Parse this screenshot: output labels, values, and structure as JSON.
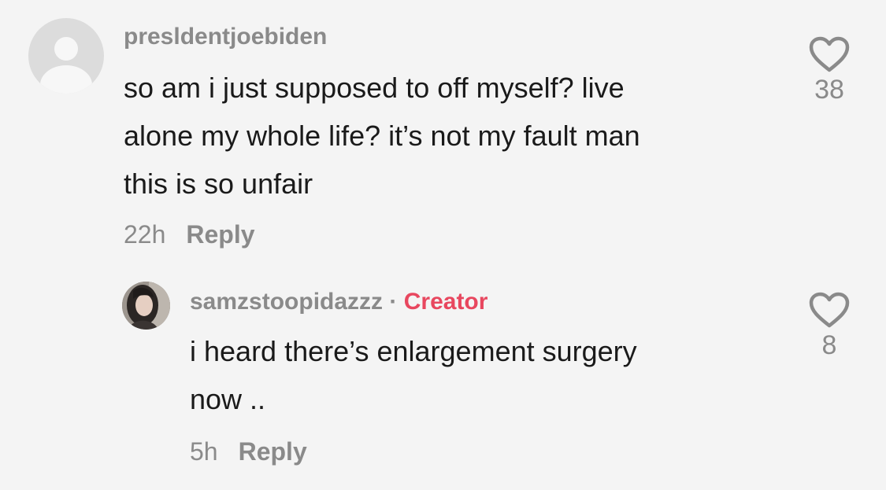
{
  "comments": [
    {
      "username": "presldentjoebiden",
      "text_lines": [
        "so am i just supposed to off myself? live",
        "alone my whole life? it’s not my fault man",
        "this is so unfair"
      ],
      "time": "22h",
      "reply_label": "Reply",
      "likes": "38",
      "avatar": "default-user-avatar"
    },
    {
      "username": "samzstoopidazzz",
      "separator": "·",
      "badge": "Creator",
      "badge_color": "#e8475f",
      "text_lines": [
        "i heard there’s enlargement surgery",
        "now .."
      ],
      "time": "5h",
      "reply_label": "Reply",
      "likes": "8",
      "avatar": "user-photo-avatar"
    }
  ],
  "icons": {
    "like": "heart-outline-icon"
  }
}
